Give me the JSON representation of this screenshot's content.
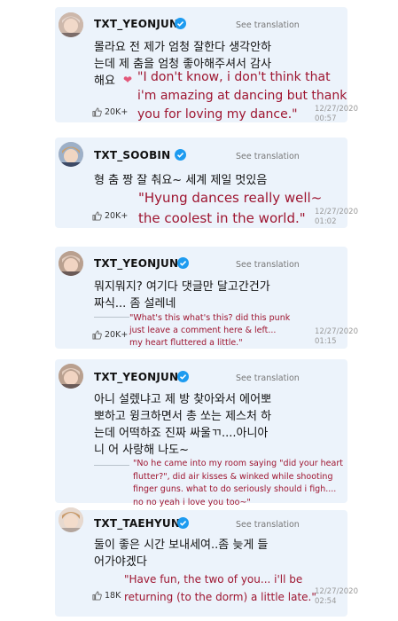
{
  "comments": [
    {
      "username": "TXT_YEONJUN",
      "see_translation": "See translation",
      "korean": "몰라요 전 제가 엄청 잘한다 생각안하\n는데 제 춤을 엄청 좋아해주셔서 감사\n해요",
      "heart": "❤",
      "english": "\"I don't know, i don't think that\ni'm amazing at dancing but thank\nyou for loving my dance.\"",
      "likes": "20K+",
      "date": "12/27/2020\n00:57"
    },
    {
      "username": "TXT_SOOBIN",
      "see_translation": "See translation",
      "korean": "형 춤 짱 잘 춰요~ 세계 제일 멋있음",
      "english": "\"Hyung dances really well~\nthe coolest in the world.\"",
      "likes": "20K+",
      "date": "12/27/2020\n01:02"
    },
    {
      "username": "TXT_YEONJUN",
      "see_translation": "See translation",
      "korean": "뭐지뭐지? 여기다 댓글만 달고간건가\n짜식... 좀 설레네",
      "english": "\"What's this what's this? did this punk\njust leave a comment here & left...\nmy heart fluttered a little.\"",
      "likes": "20K+",
      "date": "12/27/2020\n01:15"
    },
    {
      "username": "TXT_YEONJUN",
      "see_translation": "See translation",
      "korean": "아니 설렜냐고 제 방 찾아와서 에어뽀\n뽀하고 윙크하면서 총 쏘는 제스처 하\n는데 어떡하죠 진짜 싸울ㄲ....아니아\n니 어 사랑해 나도~",
      "english": "\"No he came into my room saying \"did your heart\nflutter?\", did air kisses & winked while shooting\nfinger guns. what to do seriously should i figh....\nno no yeah i love you too~\"",
      "likes": "",
      "date": ""
    },
    {
      "username": "TXT_TAEHYUN",
      "see_translation": "See translation",
      "korean": "둘이 좋은 시간 보내세여..좀 늦게 들\n어가야겠다",
      "english": "\"Have fun, the two of you... i'll be\nreturning (to the dorm) a little late.\"",
      "likes": "18K",
      "date": "12/27/2020\n02:54"
    }
  ],
  "colors": {
    "card_bg": "#ecf3fb",
    "translation_text": "#9e1530",
    "verified_badge": "#1d9bf0"
  },
  "icons": [
    "verified-badge-icon",
    "thumbs-up-icon",
    "heart-icon",
    "avatar-photo"
  ]
}
